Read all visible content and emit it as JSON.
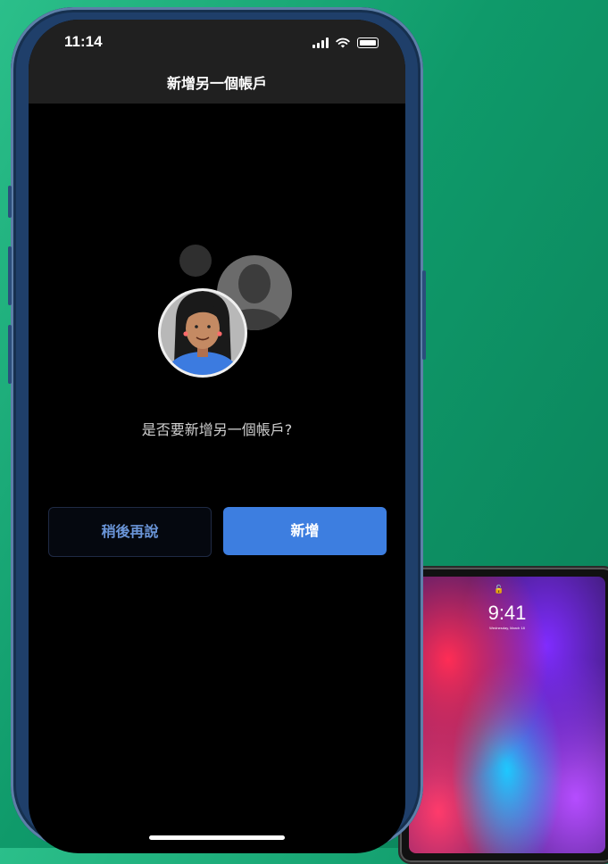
{
  "status_bar": {
    "time": "11:14"
  },
  "nav": {
    "title": "新增另一個帳戶"
  },
  "main": {
    "question": "是否要新增另一個帳戶?"
  },
  "buttons": {
    "later_label": "稍後再說",
    "add_label": "新增"
  },
  "ipad": {
    "time": "9:41",
    "date": "Wednesday, March 18"
  },
  "colors": {
    "accent": "#3d7ee0",
    "later_text": "#6a95d8",
    "background": "#0f9a6a"
  }
}
